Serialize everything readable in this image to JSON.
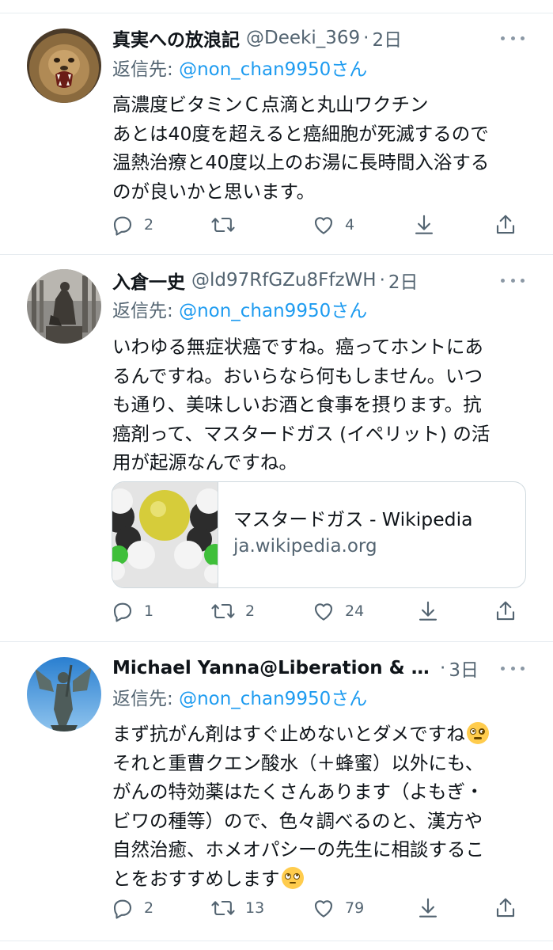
{
  "colors": {
    "text_primary": "#0f1419",
    "text_secondary": "#536471",
    "mention": "#1d9bf0",
    "divider": "#e6ecf0",
    "icon": "#536471"
  },
  "replies": [
    {
      "display_name": "真実への放浪記",
      "handle": "@Deeki_369",
      "separator": "·",
      "time": "2日",
      "reply_prefix": "返信先: ",
      "reply_to": "@non_chan9950",
      "reply_suffix": "さん",
      "text_lines": [
        "高濃度ビタミンＣ点滴と丸山ワクチン",
        "あとは40度を超えると癌細胞が死滅するので",
        "温熱治療と40度以上のお湯に長時間入浴する",
        "のが良いかと思います。"
      ],
      "reply_count": "2",
      "retweet_count": "",
      "like_count": "4",
      "avatar_icon": "lion-avatar"
    },
    {
      "display_name": "入倉一史",
      "handle": "@ld97RfGZu8FfzWH",
      "separator": "·",
      "time": "2日",
      "reply_prefix": "返信先: ",
      "reply_to": "@non_chan9950",
      "reply_suffix": "さん",
      "text_lines": [
        "いわゆる無症状癌ですね。癌ってホントにあ",
        "るんですね。おいらなら何もしません。いつ",
        "も通り、美味しいお酒と食事を摂ります。抗",
        "癌剤って、マスタードガス (イペリット) の活",
        "用が起源なんですね。"
      ],
      "card": {
        "title": "マスタードガス - Wikipedia",
        "domain": "ja.wikipedia.org"
      },
      "reply_count": "1",
      "retweet_count": "2",
      "like_count": "24",
      "avatar_icon": "statue-avatar"
    },
    {
      "display_name": "Michael Yanna@Liberation & N...",
      "handle": "",
      "separator": "·",
      "time": "3日",
      "reply_prefix": "返信先: ",
      "reply_to": "@non_chan9950",
      "reply_suffix": "さん",
      "text_lines": [
        "まず抗がん剤はすぐ止めないとダメですね",
        "それと重曹クエン酸水（＋蜂蜜）以外にも、",
        "がんの特効薬はたくさんあります（よもぎ・",
        "ビワの種等）ので、色々調べるのと、漢方や",
        "自然治癒、ホメオパシーの先生に相談するこ",
        "とをおすすめします"
      ],
      "reply_count": "2",
      "retweet_count": "13",
      "like_count": "79",
      "avatar_icon": "archangel-avatar",
      "emoji_line_0": "face-with-monocle-emoji",
      "emoji_line_5": "face-with-rolling-eyes-emoji"
    }
  ]
}
